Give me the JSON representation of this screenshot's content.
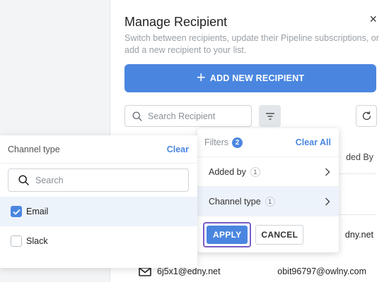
{
  "modal": {
    "title": "Manage Recipient",
    "subtitle": "Switch between recipients, update their Pipeline subscriptions, or add a new recipient to your list.",
    "close_label": "×",
    "add_button_label": "ADD NEW RECIPIENT",
    "search_placeholder": "Search Recipient",
    "table": {
      "column_partial": "ded By",
      "row_partial_value": "dny.net",
      "last_row": {
        "email": "6j5x1@edny.net",
        "added_by": "obit96797@owlny.com"
      }
    }
  },
  "filters": {
    "label": "Filters",
    "count": "2",
    "clear_all_label": "Clear All",
    "items": [
      {
        "label": "Added by",
        "count": "1"
      },
      {
        "label": "Channel type",
        "count": "1"
      }
    ],
    "apply_label": "APPLY",
    "cancel_label": "CANCEL"
  },
  "channel_type": {
    "label": "Channel type",
    "clear_label": "Clear",
    "search_placeholder": "Search",
    "options": [
      {
        "label": "Email",
        "checked": true
      },
      {
        "label": "Slack",
        "checked": false
      }
    ]
  },
  "colors": {
    "accent": "#4a86e0",
    "focus_ring": "#7b5cc8",
    "active_row": "#edf3fb"
  }
}
